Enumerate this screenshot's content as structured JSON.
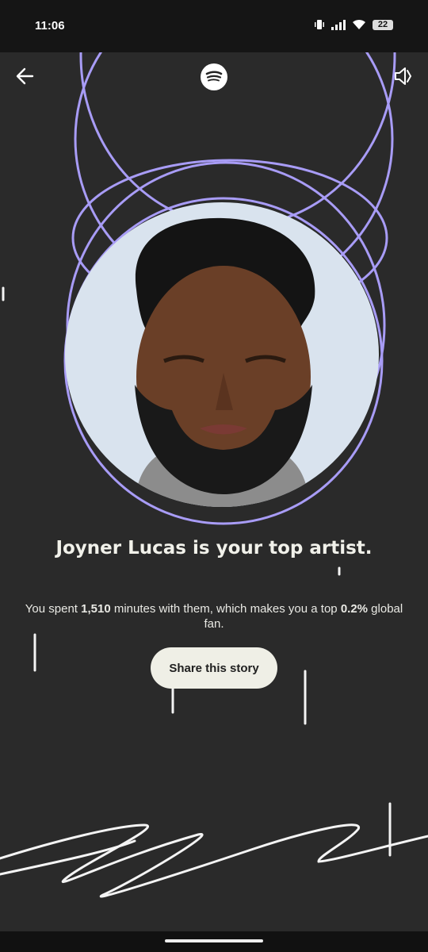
{
  "status_bar": {
    "time": "11:06",
    "battery": "22",
    "icons": [
      "vibrate-icon",
      "signal-icon",
      "wifi-icon",
      "battery-icon"
    ]
  },
  "header": {
    "back_icon": "arrow-left-icon",
    "logo_icon": "spotify-logo-icon",
    "sound_icon": "speaker-muted-icon"
  },
  "story": {
    "artist": "Joyner Lucas",
    "headline": "Joyner Lucas is your top artist.",
    "sub_prefix": "You spent ",
    "minutes": "1,510",
    "sub_middle": " minutes with them, which makes you a top ",
    "percent": "0.2%",
    "sub_suffix": " global fan.",
    "share_label": "Share this story"
  },
  "colors": {
    "background": "#2a2a2a",
    "accent_lavender": "#a89cf6",
    "text_light": "#f1f1ea",
    "button_bg": "#efefe6"
  }
}
